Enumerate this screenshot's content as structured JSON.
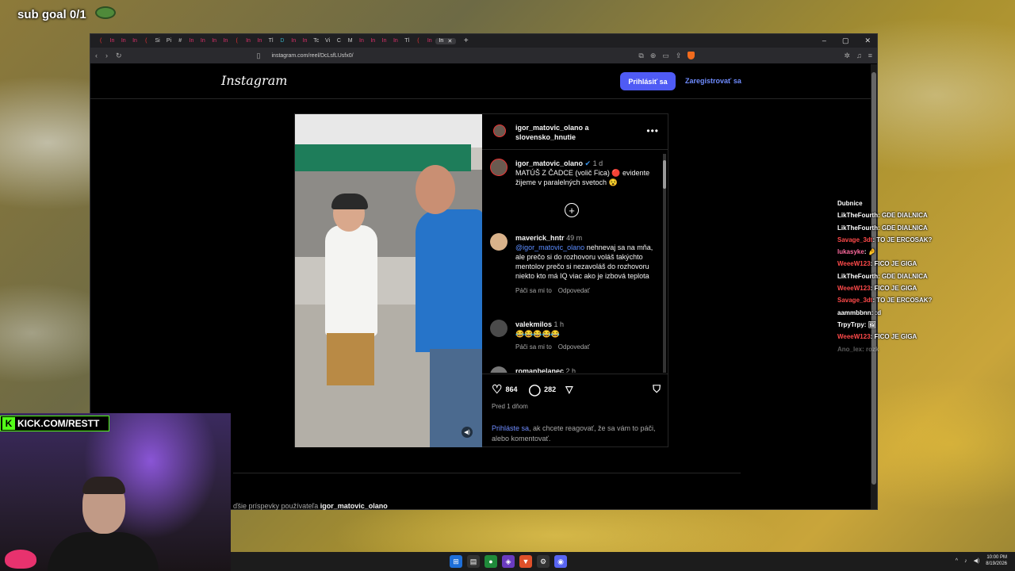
{
  "overlay": {
    "sub_goal": "sub goal 0/1",
    "kick_badge": "KICK.COM/RESTT"
  },
  "browser": {
    "tab_favicon_labels": [
      "(",
      "In",
      "In",
      "In",
      "(",
      "Si",
      "Pi",
      "#",
      "In",
      "In",
      "In",
      "In",
      "(",
      "In",
      "In",
      "Tl",
      "D",
      "In",
      "In",
      "Tc",
      "Vi",
      "C",
      "M",
      "In",
      "In",
      "In",
      "In",
      "Tl",
      "(",
      "In"
    ],
    "active_tab_label": "In",
    "url": "instagram.com/reel/DcLsfLUsfx0/"
  },
  "instagram": {
    "logo": "Instagram",
    "login_button": "Prihlásiť sa",
    "register_link": "Zaregistrovať sa",
    "post_header": "igor_matovic_olano a slovensko_hnutie",
    "caption": {
      "user": "igor_matovic_olano",
      "verified_icon": "✔",
      "time": "1 d",
      "text": "MATÚŠ Z ČADCE (volič Fica) 🔴 evidente žijeme v paralelných svetoch 😵"
    },
    "comments": [
      {
        "user": "maverick_hntr",
        "time": "49 m",
        "mention": "@igor_matovic_olano",
        "text": " nehnevaj sa na mňa, ale prečo si do rozhovoru voláš takýchto mentolov prečo si nezavoláš do rozhovoru niekto kto má IQ viac ako je izbová teplota",
        "like": "Páči sa mi to",
        "reply": "Odpovedať"
      },
      {
        "user": "valekmilos",
        "time": "1 h",
        "text": "😂😂😂😂😂",
        "like": "Páči sa mi to",
        "reply": "Odpovedať"
      },
      {
        "user": "romanbelanec",
        "time": "2 h"
      }
    ],
    "likes": "864",
    "comments_count": "282",
    "posted": "Pred 1 dňom",
    "login_prompt_link": "Prihláste sa",
    "login_prompt_text": ", ak chcete reagovať, že sa vám to páči, alebo komentovať.",
    "more_posts_prefix": "ďšie príspevky používateľa",
    "more_posts_user": "igor_matovic_olano"
  },
  "chat": [
    {
      "user": "Dubnice",
      "msg": "",
      "color": "#ffffff"
    },
    {
      "user": "LikTheFourth",
      "msg": ": GDE DIALNICA",
      "color": "#ffffff"
    },
    {
      "user": "LikTheFourth",
      "msg": ": GDE DIALNICA",
      "color": "#ffffff"
    },
    {
      "user": "Savage_3dt",
      "msg": ": TO JE ERCOSAK?",
      "color": "#ff4a4a"
    },
    {
      "user": "lukasyke",
      "msg": ": 🤌",
      "color": "#ff6b9f"
    },
    {
      "user": "WeeeW123",
      "msg": ": FICO JE GIGA",
      "color": "#ff4a4a"
    },
    {
      "user": "LikTheFourth",
      "msg": ": GDE DIALNICA",
      "color": "#ffffff"
    },
    {
      "user": "WeeeW123",
      "msg": ": FICO JE GIGA",
      "color": "#ff4a4a"
    },
    {
      "user": "Savage_3dt",
      "msg": ": TO JE ERCOSAK?",
      "color": "#ff4a4a"
    },
    {
      "user": "aammbbnn",
      "msg": ": :d",
      "color": "#ffffff"
    },
    {
      "user": "TrpyTrpy",
      "msg": ": 🖼",
      "color": "#ffffff"
    },
    {
      "user": "WeeeW123",
      "msg": ": FICO JE GIGA",
      "color": "#ff4a4a"
    },
    {
      "user": "Ano_lex",
      "msg": ": rozk",
      "color": "#ffffff"
    }
  ],
  "taskbar": {
    "time": "10:00 PM",
    "date": "8/19/2026"
  }
}
